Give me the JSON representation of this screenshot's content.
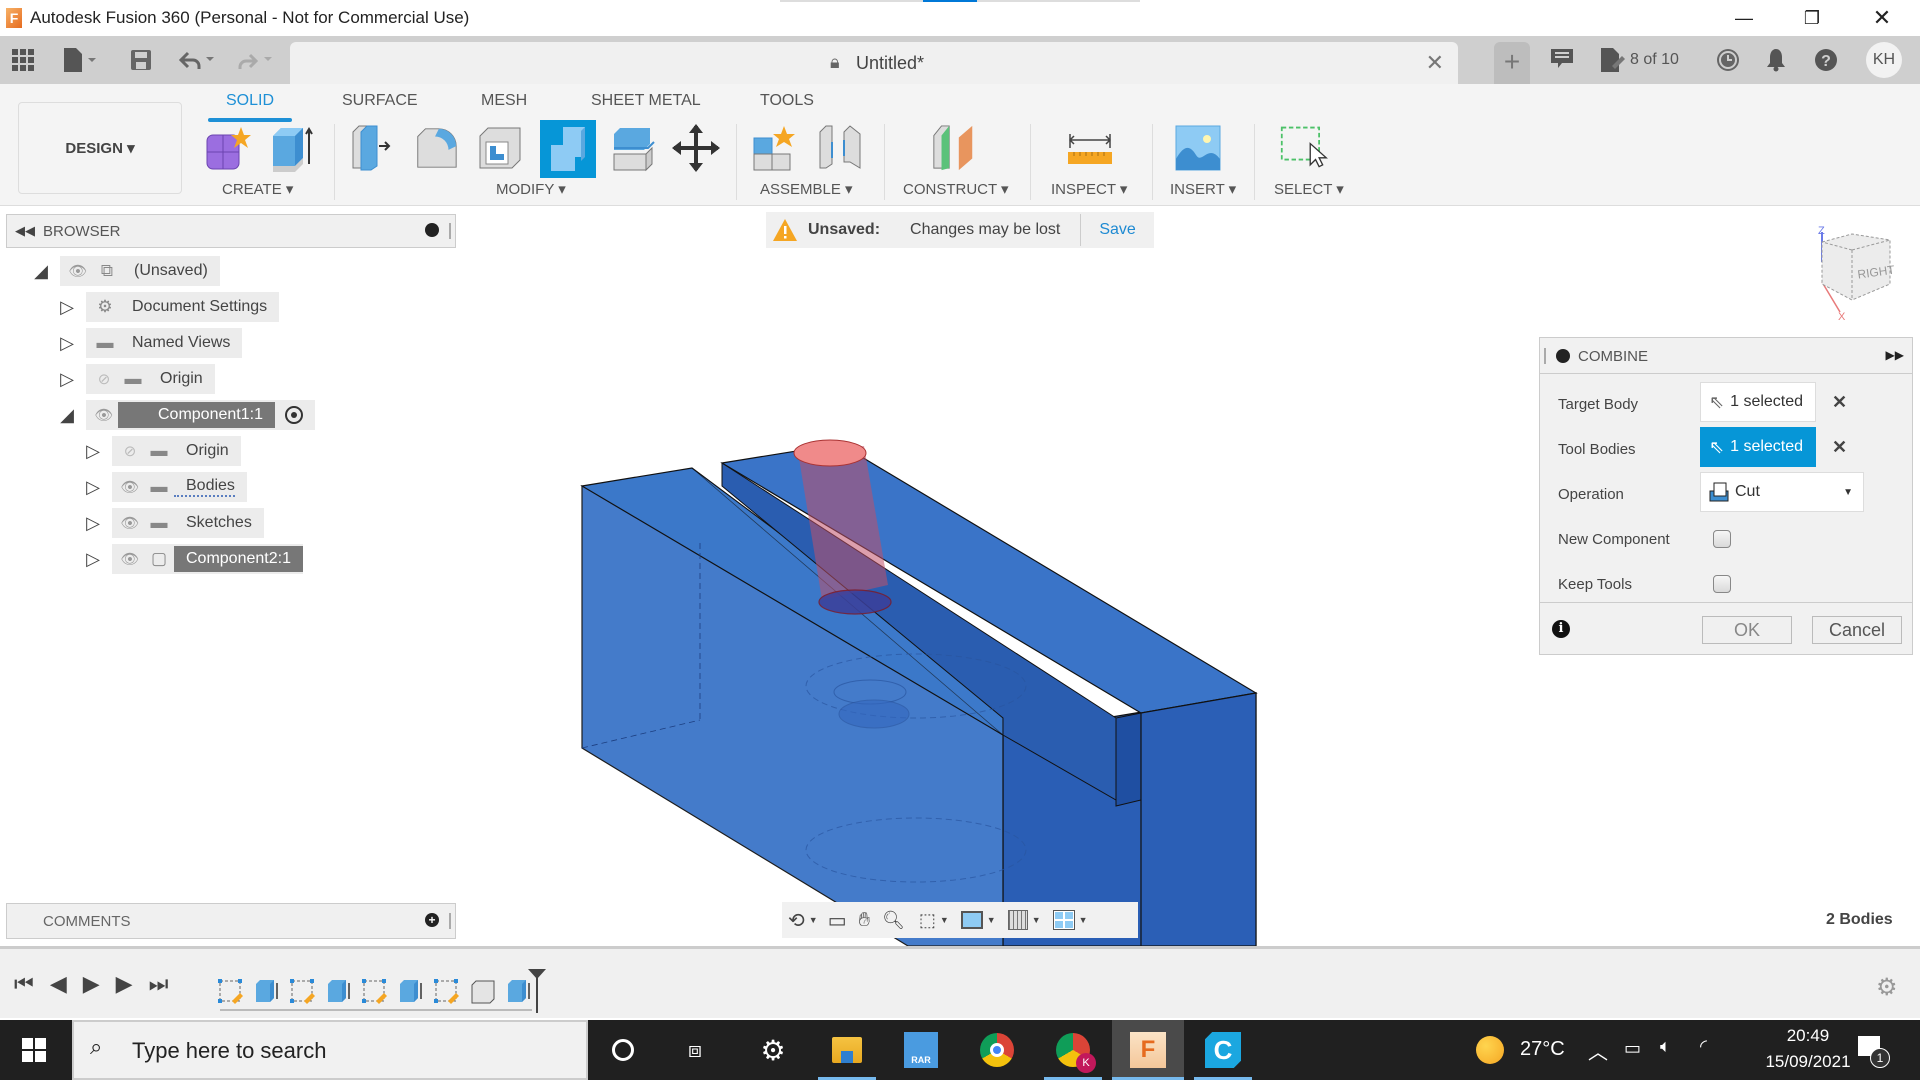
{
  "window": {
    "app_icon": "fusion-360-logo-icon",
    "title": "Autodesk Fusion 360 (Personal - Not for Commercial Use)",
    "controls": {
      "minimize": "—",
      "restore": "❐",
      "close": "✕"
    }
  },
  "tabbar": {
    "document_title": "Untitled*",
    "lock_icon": "lock-icon",
    "close_tab": "✕",
    "new_tab": "+",
    "job_status": "8 of 10",
    "avatar_initials": "KH"
  },
  "ribbon": {
    "workspace": "DESIGN ▾",
    "tabs": [
      {
        "label": "SOLID",
        "active": true
      },
      {
        "label": "SURFACE",
        "active": false
      },
      {
        "label": "MESH",
        "active": false
      },
      {
        "label": "SHEET METAL",
        "active": false
      },
      {
        "label": "TOOLS",
        "active": false
      }
    ],
    "groups": {
      "create": "CREATE ▾",
      "modify": "MODIFY ▾",
      "assemble": "ASSEMBLE ▾",
      "construct": "CONSTRUCT ▾",
      "inspect": "INSPECT ▾",
      "insert": "INSERT ▾",
      "select": "SELECT ▾"
    },
    "tools": {
      "create": [
        "new-component",
        "extrude"
      ],
      "modify": [
        "press-pull",
        "fillet",
        "shell",
        "combine",
        "split-face",
        "move-copy"
      ],
      "assemble": [
        "new-component-assemble",
        "joint"
      ],
      "construct": [
        "offset-plane"
      ],
      "inspect": [
        "measure"
      ],
      "insert": [
        "insert-image"
      ],
      "select": [
        "select-window"
      ]
    },
    "active_tool": "combine",
    "accent_color": "#1e90d6"
  },
  "browser": {
    "title": "BROWSER",
    "items": [
      {
        "label": "(Unsaved)",
        "level": 0,
        "expanded": true,
        "visible": true,
        "icon": "component-icon"
      },
      {
        "label": "Document Settings",
        "level": 1,
        "expanded": false,
        "icon": "gear-icon"
      },
      {
        "label": "Named Views",
        "level": 1,
        "expanded": false,
        "icon": "folder-icon"
      },
      {
        "label": "Origin",
        "level": 1,
        "expanded": false,
        "visible": false,
        "icon": "folder-icon"
      },
      {
        "label": "Component1:1",
        "level": 1,
        "expanded": true,
        "visible": true,
        "icon": "component-icon",
        "highlighted": true,
        "active_radio": true
      },
      {
        "label": "Origin",
        "level": 2,
        "expanded": false,
        "visible": false,
        "icon": "folder-icon"
      },
      {
        "label": "Bodies",
        "level": 2,
        "expanded": false,
        "visible": true,
        "icon": "folder-icon"
      },
      {
        "label": "Sketches",
        "level": 2,
        "expanded": false,
        "visible": true,
        "icon": "folder-icon"
      },
      {
        "label": "Component2:1",
        "level": 2,
        "expanded": false,
        "visible": true,
        "icon": "body-icon",
        "highlighted": true
      }
    ]
  },
  "notification": {
    "label": "Unsaved:",
    "message": "Changes may be lost",
    "action": "Save"
  },
  "viewcube": {
    "face": "RIGHT",
    "axis_z": "Z",
    "axis_x": "X"
  },
  "combine": {
    "title": "COMBINE",
    "target_body_label": "Target Body",
    "target_body_value": "1 selected",
    "tool_bodies_label": "Tool Bodies",
    "tool_bodies_value": "1 selected",
    "operation_label": "Operation",
    "operation_value": "Cut",
    "new_component_label": "New Component",
    "new_component_checked": false,
    "keep_tools_label": "Keep Tools",
    "keep_tools_checked": false,
    "ok": "OK",
    "cancel": "Cancel"
  },
  "comments": {
    "title": "COMMENTS"
  },
  "status": {
    "bodies": "2 Bodies"
  },
  "timeline": {
    "features": [
      "sketch",
      "extrude",
      "sketch",
      "extrude",
      "sketch",
      "extrude",
      "sketch",
      "component",
      "extrude"
    ]
  },
  "taskbar": {
    "search_placeholder": "Type here to search",
    "apps": [
      "cortana",
      "task-view",
      "settings",
      "file-explorer",
      "winrar",
      "chrome",
      "chrome-profile-k",
      "fusion-360",
      "cura"
    ],
    "weather": "27°C",
    "time": "20:49",
    "date": "15/09/2021",
    "notifications": "1"
  }
}
